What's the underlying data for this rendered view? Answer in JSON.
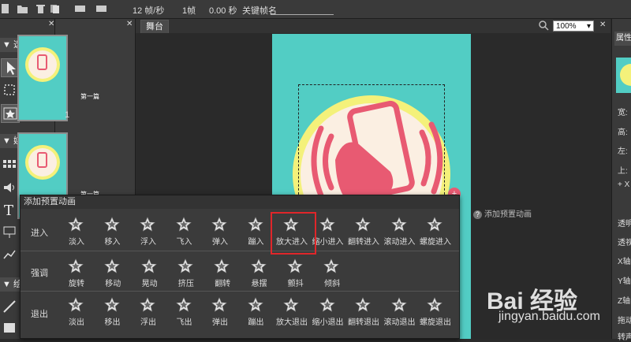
{
  "toolbar": {
    "fps": "12 帧/秒",
    "frame": "1帧",
    "time": "0.00 秒",
    "keyframe_label": "关键帧名"
  },
  "sections": {
    "select": "▼ 选择",
    "media": "▼ 媒体",
    "third": "▼ 绘"
  },
  "thumbs": {
    "index": "1",
    "caption": "第一篇"
  },
  "stage": {
    "tab": "舞台",
    "zoom": "100%"
  },
  "right": {
    "tab": "属性",
    "labels": [
      "宽:",
      "高:",
      "左:",
      "上:",
      "+ X",
      "透明",
      "透视",
      "X轴",
      "Y轴",
      "Z轴",
      "拖动",
      "转声"
    ]
  },
  "popup": {
    "title": "添加预置动画",
    "hint": "添加预置动画",
    "rows": [
      {
        "label": "进入",
        "items": [
          "淡入",
          "移入",
          "浮入",
          "飞入",
          "弹入",
          "蹦入",
          "放大进入",
          "缩小进入",
          "翻转进入",
          "滚动进入",
          "螺旋进入"
        ]
      },
      {
        "label": "强调",
        "items": [
          "旋转",
          "移动",
          "晃动",
          "挤压",
          "翻转",
          "悬摆",
          "颤抖",
          "倾斜"
        ]
      },
      {
        "label": "退出",
        "items": [
          "淡出",
          "移出",
          "浮出",
          "飞出",
          "弹出",
          "蹦出",
          "放大退出",
          "缩小退出",
          "翻转退出",
          "滚动退出",
          "螺旋退出"
        ]
      }
    ]
  },
  "watermark": {
    "brand": "Bai 经验",
    "url": "jingyan.baidu.com"
  },
  "colors": {
    "canvas": "#52cdc4",
    "circle_outer": "#f4f17a",
    "circle_inner": "#fbefe2",
    "phone": "#e85a72",
    "highlight": "#e0262a"
  }
}
